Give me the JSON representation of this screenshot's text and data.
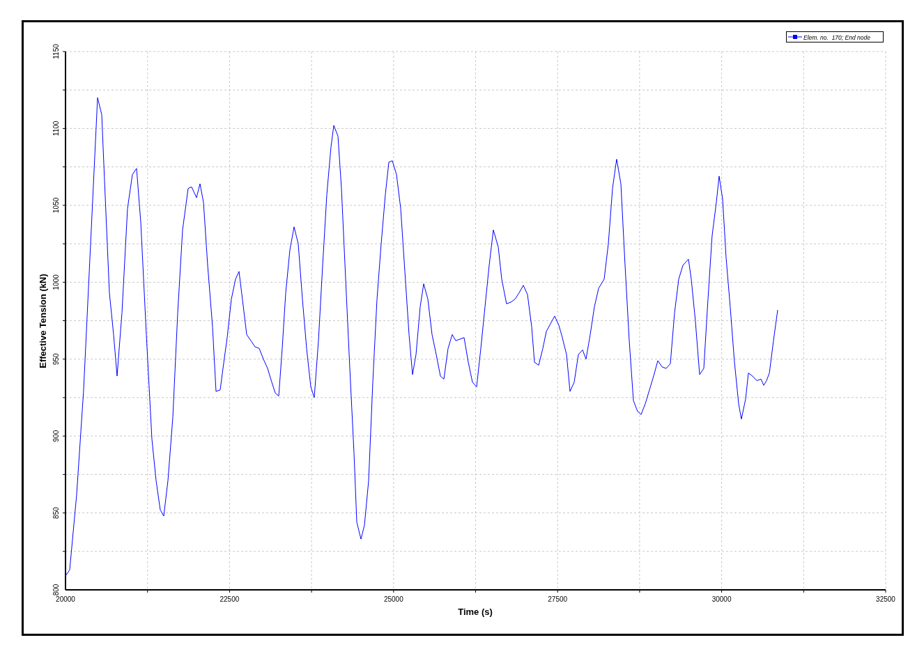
{
  "chart": {
    "chart_data": {
      "type": "line",
      "grid": true,
      "xlabel": "Time (s)",
      "ylabel": "Effective Tension (kN)",
      "xlim": [
        20000,
        32500
      ],
      "ylim": [
        800,
        1150
      ],
      "xticks": [
        20000,
        22500,
        25000,
        27500,
        30000,
        32500
      ],
      "yticks": [
        800,
        850,
        900,
        950,
        1000,
        1050,
        1100,
        1150
      ],
      "x": [
        20000,
        20064,
        20170,
        20276,
        20382,
        20489,
        20552,
        20595,
        20669,
        20733,
        20786,
        20860,
        20945,
        21020,
        21083,
        21147,
        21232,
        21317,
        21381,
        21444,
        21497,
        21561,
        21635,
        21710,
        21784,
        21869,
        21922,
        21997,
        22050,
        22103,
        22166,
        22241,
        22294,
        22358,
        22400,
        22464,
        22528,
        22591,
        22644,
        22697,
        22761,
        22825,
        22889,
        22952,
        23016,
        23080,
        23144,
        23197,
        23250,
        23303,
        23356,
        23420,
        23483,
        23547,
        23611,
        23675,
        23738,
        23791,
        23855,
        23919,
        23983,
        24046,
        24089,
        24152,
        24206,
        24269,
        24333,
        24397,
        24439,
        24503,
        24556,
        24620,
        24683,
        24747,
        24811,
        24875,
        24928,
        24981,
        25045,
        25108,
        25172,
        25236,
        25289,
        25342,
        25406,
        25459,
        25522,
        25586,
        25650,
        25714,
        25767,
        25830,
        25894,
        25947,
        26011,
        26075,
        26138,
        26202,
        26266,
        26330,
        26393,
        26457,
        26521,
        26595,
        26648,
        26722,
        26786,
        26850,
        26913,
        26977,
        27041,
        27105,
        27147,
        27211,
        27275,
        27328,
        27392,
        27455,
        27519,
        27572,
        27636,
        27689,
        27753,
        27816,
        27880,
        27933,
        27997,
        28061,
        28124,
        28209,
        28273,
        28337,
        28400,
        28464,
        28528,
        28592,
        28655,
        28719,
        28772,
        28836,
        28900,
        28963,
        29027,
        29091,
        29154,
        29218,
        29282,
        29346,
        29409,
        29494,
        29537,
        29600,
        29664,
        29728,
        29792,
        29855,
        29919,
        29962,
        30015,
        30068,
        30131,
        30195,
        30259,
        30301,
        30365,
        30408,
        30471,
        30535,
        30599,
        30641,
        30684,
        30727,
        30790,
        30854
      ],
      "series": [
        {
          "name": "Elem. no.  170; End node",
          "color": "#0000ff",
          "values": [
            809,
            813,
            862,
            930,
            1025,
            1120,
            1109,
            1066,
            993,
            966,
            939,
            980,
            1048,
            1070,
            1074,
            1039,
            966,
            898,
            871,
            852,
            848,
            871,
            912,
            980,
            1034,
            1061,
            1062,
            1055,
            1064,
            1052,
            1011,
            971,
            929,
            930,
            944,
            964,
            989,
            1002,
            1007,
            989,
            966,
            962,
            958,
            957,
            950,
            944,
            935,
            928,
            926,
            957,
            993,
            1021,
            1036,
            1025,
            989,
            957,
            932,
            925,
            962,
            1011,
            1057,
            1088,
            1102,
            1095,
            1061,
            1002,
            944,
            889,
            844,
            833,
            842,
            871,
            935,
            989,
            1025,
            1057,
            1078,
            1079,
            1070,
            1048,
            1007,
            966,
            940,
            953,
            984,
            999,
            989,
            966,
            953,
            939,
            937,
            957,
            966,
            962,
            963,
            964,
            948,
            935,
            932,
            957,
            984,
            1011,
            1034,
            1023,
            1002,
            986,
            987,
            989,
            993,
            998,
            992,
            971,
            948,
            946,
            957,
            968,
            973,
            978,
            972,
            964,
            953,
            929,
            935,
            953,
            956,
            950,
            966,
            984,
            996,
            1002,
            1025,
            1061,
            1080,
            1064,
            1011,
            962,
            923,
            916,
            914,
            921,
            930,
            939,
            949,
            945,
            944,
            947,
            980,
            1002,
            1011,
            1015,
            1002,
            975,
            940,
            944,
            989,
            1030,
            1052,
            1069,
            1054,
            1016,
            984,
            948,
            921,
            911,
            924,
            941,
            939,
            936,
            937,
            933,
            936,
            941,
            962,
            982
          ]
        }
      ]
    }
  }
}
